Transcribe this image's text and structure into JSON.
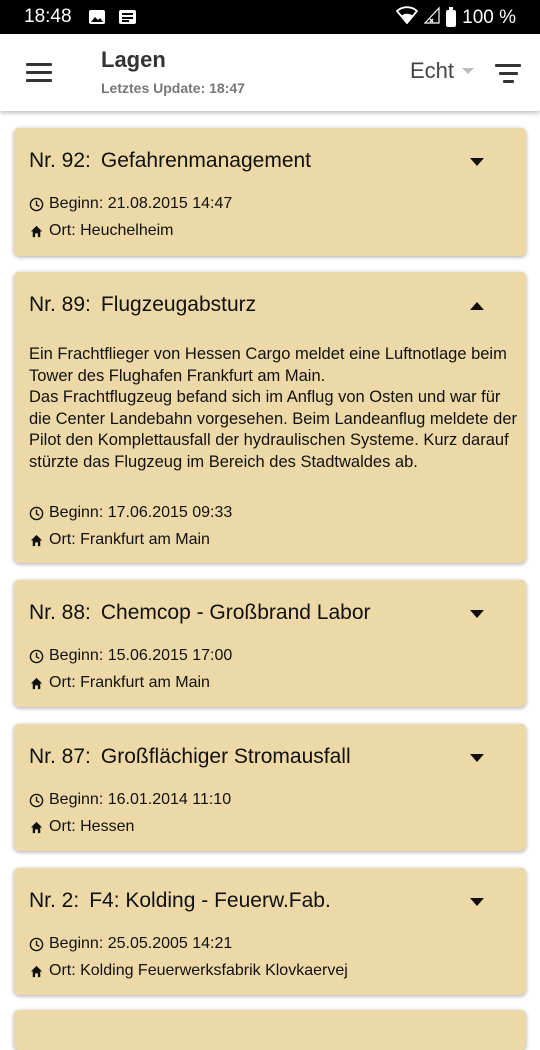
{
  "status_bar": {
    "time": "18:48",
    "battery": "100 %",
    "icons": [
      "image-icon",
      "news-icon",
      "wifi-icon",
      "signal-icon",
      "battery-icon"
    ]
  },
  "app_bar": {
    "title": "Lagen",
    "subtitle": "Letztes Update: 18:47",
    "mode": "Echt",
    "icons": [
      "menu-icon",
      "dropdown-caret-icon",
      "filter-icon"
    ]
  },
  "colors": {
    "card_background": "#ecd9a7",
    "status_bar": "#000000",
    "app_bar": "#ffffff"
  },
  "cards": [
    {
      "number": "Nr. 92:",
      "name": "Gefahrenmanagement",
      "expanded": false,
      "begin": "Beginn: 21.08.2015 14:47",
      "location": "Ort: Heuchelheim"
    },
    {
      "number": "Nr. 89:",
      "name": "Flugzeugabsturz",
      "expanded": true,
      "description_1": "Ein Frachtflieger von Hessen Cargo meldet eine Luftnotlage beim Tower des Flughafen Frankfurt am Main.",
      "description_2": "Das Frachtflugzeug befand sich im Anflug von Osten und war für die Center Landebahn vorgesehen. Beim Landeanflug meldete der Pilot den Komplettausfall der hydraulischen Systeme. Kurz darauf stürzte das Flugzeug im Bereich des Stadtwaldes ab.",
      "begin": "Beginn: 17.06.2015 09:33",
      "location": "Ort: Frankfurt am Main"
    },
    {
      "number": "Nr. 88:",
      "name": "Chemcop - Großbrand Labor",
      "expanded": false,
      "begin": "Beginn: 15.06.2015 17:00",
      "location": "Ort: Frankfurt am Main"
    },
    {
      "number": "Nr. 87:",
      "name": "Großflächiger Stromausfall",
      "expanded": false,
      "begin": "Beginn: 16.01.2014 11:10",
      "location": "Ort: Hessen"
    },
    {
      "number": "Nr. 2:",
      "name": "F4: Kolding - Feuerw.Fab.",
      "expanded": false,
      "begin": "Beginn: 25.05.2005 14:21",
      "location": "Ort: Kolding Feuerwerksfabrik Klovkaervej"
    }
  ]
}
